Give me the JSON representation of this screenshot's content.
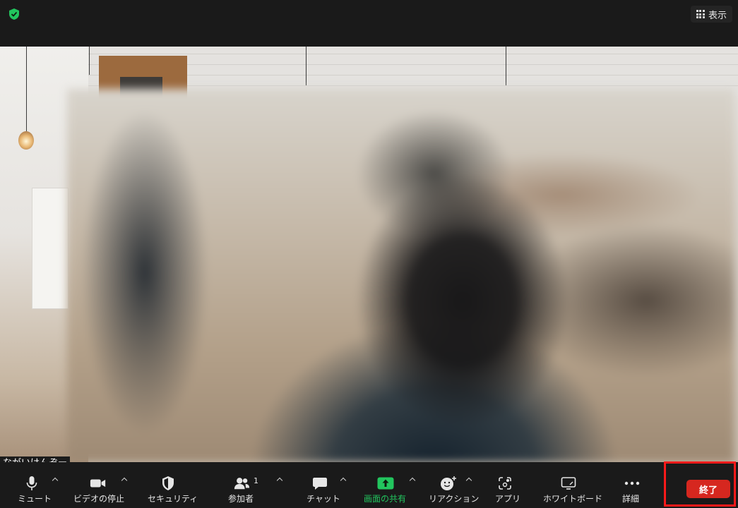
{
  "header": {
    "view_label": "表示"
  },
  "participant": {
    "name": "ながいけんぞー"
  },
  "toolbar": {
    "mute_label": "ミュート",
    "video_label": "ビデオの停止",
    "security_label": "セキュリティ",
    "participants_label": "参加者",
    "participants_count": "1",
    "chat_label": "チャット",
    "share_label": "画面の共有",
    "reactions_label": "リアクション",
    "apps_label": "アプリ",
    "whiteboard_label": "ホワイトボード",
    "more_label": "詳細",
    "end_label": "終了"
  },
  "colors": {
    "share_green": "#22c55e",
    "end_red": "#d6271f",
    "highlight_red": "#ff1a1a",
    "shield_green": "#22c55e"
  }
}
